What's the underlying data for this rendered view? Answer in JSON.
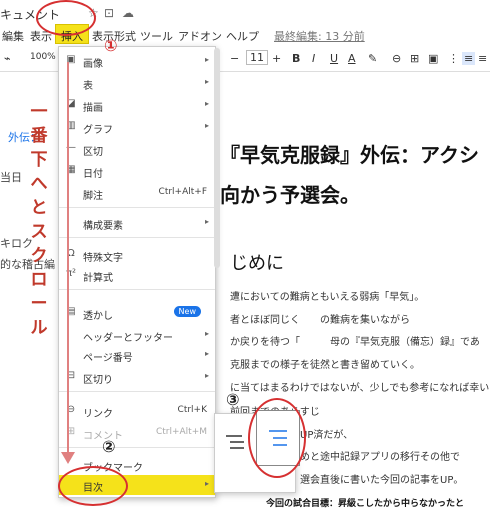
{
  "title_bar": {
    "doc_title": "キュメント",
    "star": "☆",
    "move": "⊡",
    "cloud": "☁"
  },
  "menubar": {
    "items": [
      "編集",
      "表示",
      "挿入",
      "表示形式",
      "ツール",
      "アドオン",
      "ヘルプ"
    ],
    "last_edit": "最終編集: 13 分前"
  },
  "toolbar": {
    "zoom": "100%",
    "font_minus": "−",
    "font_size": "11",
    "font_plus": "+",
    "bold": "B",
    "italic": "I",
    "underline": "U",
    "text_color": "A"
  },
  "document": {
    "left_notes": [
      "外伝：",
      "当日",
      "キロク",
      "的な稽古編"
    ],
    "heading_line1": "『早気克服録』外伝：アクシ",
    "heading_line2": "向かう予選会。",
    "subheading": "じめに",
    "lines": [
      "遭においての難病ともいえる弱病「早気」。",
      "者とほぼ同じく　　の難病を集いながら",
      "か戻りを待つ「　　　母の『早気克服（備忘）録』であ",
      "克服までの様子を徒然と書き留めていく。",
      "に当てはまるわけではないが、少しでも参考になれば幸い",
      "前回までのあらすじ",
      "UP済だが、",
      "めと途中記録アプリの移行その他で",
      "選会直後に書いた今回の記事をUP。"
    ],
    "bottom_text": "今回の試合目標：昇級こしたから中らなかったと"
  },
  "insert_menu": {
    "items": [
      {
        "icon": "▣",
        "label": "画像",
        "arrow": "▸"
      },
      {
        "icon": "",
        "label": "表",
        "arrow": "▸"
      },
      {
        "icon": "◪",
        "label": "描画",
        "arrow": "▸"
      },
      {
        "icon": "▥",
        "label": "グラフ",
        "arrow": "▸"
      },
      {
        "icon": "—",
        "label": "区切"
      },
      {
        "icon": "▦",
        "label": "日付"
      },
      {
        "icon": "",
        "label": "脚注",
        "shortcut": "Ctrl+Alt+F"
      },
      {
        "icon": "",
        "label": "構成要素",
        "arrow": "▸"
      },
      {
        "icon": "Ω",
        "label": "特殊文字"
      },
      {
        "icon": "π²",
        "label": "計算式"
      },
      {
        "icon": "▤",
        "label": "透かし",
        "badge": "New"
      },
      {
        "icon": "",
        "label": "ヘッダーとフッター",
        "arrow": "▸"
      },
      {
        "icon": "",
        "label": "ページ番号",
        "arrow": "▸"
      },
      {
        "icon": "⊟",
        "label": "区切り",
        "arrow": "▸"
      },
      {
        "icon": "⊖",
        "label": "リンク",
        "shortcut": "Ctrl+K"
      },
      {
        "icon": "⊞",
        "label": "コメント",
        "shortcut": "Ctrl+Alt+M",
        "disabled": true
      },
      {
        "icon": "",
        "label": "ブックマーク"
      },
      {
        "icon": "",
        "label": "目次",
        "arrow": "▸"
      }
    ]
  },
  "annotations": {
    "vertical_text": [
      "一",
      "番",
      "下",
      "へ",
      "と",
      "ス",
      "ク",
      "ロ",
      "ー",
      "ル"
    ],
    "num1": "①",
    "num2": "②",
    "num3": "③"
  },
  "colors": {
    "highlight": "#f5e21a",
    "annotation_red": "#d63031",
    "badge_blue": "#1a73e8"
  }
}
